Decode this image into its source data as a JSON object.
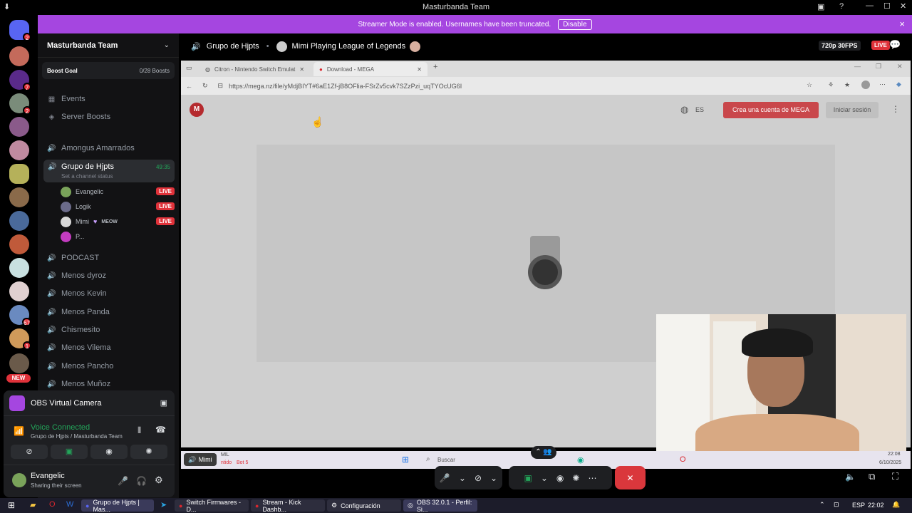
{
  "window": {
    "title": "Masturbanda Team"
  },
  "banner": {
    "message": "Streamer Mode is enabled. Usernames have been truncated.",
    "disable_label": "Disable",
    "close_icon": "×"
  },
  "server": {
    "name": "Masturbanda Team",
    "boost_goal_label": "Boost Goal",
    "boost_count": "0/28 Boosts"
  },
  "sidebar": {
    "menu": [
      {
        "label": "Events",
        "icon": "calendar-icon"
      },
      {
        "label": "Server Boosts",
        "icon": "boost-icon"
      }
    ],
    "channels_before": [
      {
        "label": "Amongus Amarrados"
      }
    ],
    "active_channel": {
      "label": "Grupo de Hjpts",
      "timer": "49:35",
      "status": "Set a channel status"
    },
    "voice_users": [
      {
        "name": "Evangelic",
        "live": "LIVE",
        "color": "#7aa35a"
      },
      {
        "name": "Logik",
        "live": "LIVE",
        "color": "#6b6b8a"
      },
      {
        "name": "Mimi",
        "tag": "MEOW",
        "live": "LIVE",
        "color": "#d8d8d8"
      },
      {
        "name": "P...",
        "color": "#c33cc0"
      }
    ],
    "channels_after": [
      {
        "label": "PODCAST"
      },
      {
        "label": "Menos dyroz"
      },
      {
        "label": "Menos Kevin"
      },
      {
        "label": "Menos Panda"
      },
      {
        "label": "Chismesito"
      },
      {
        "label": "Menos Vilema"
      },
      {
        "label": "Menos Pancho"
      },
      {
        "label": "Menos Muñoz"
      }
    ]
  },
  "server_list": {
    "new_label": "NEW",
    "badges": [
      "2",
      "7",
      "2",
      "67",
      "1"
    ]
  },
  "obs": {
    "label": "OBS Virtual Camera"
  },
  "voice": {
    "status": "Voice Connected",
    "location": "Grupo de Hjpts / Masturbanda Team"
  },
  "user": {
    "name": "Evangelic",
    "status": "Sharing their screen"
  },
  "stream_header": {
    "channel": "Grupo de Hjpts",
    "stream_title": "Mimi Playing League of Legends",
    "quality": "720p 30FPS",
    "live": "LIVE"
  },
  "browser": {
    "tabs": [
      {
        "label": "Citron - Nintendo Switch Emulat"
      },
      {
        "label": "Download - MEGA"
      }
    ],
    "url": "https://mega.nz/file/yMdjBIYT#6aE1Zf-jB8OFlia-FSrZv5cvk7SZzPzi_uqTYOcUG6I",
    "lang": "ES",
    "create_account": "Crea una cuenta de MEGA",
    "login": "Iniciar sesión"
  },
  "stream_overlay": {
    "viewer_label": "Mimi",
    "taskbar_text1": "MIL",
    "taskbar_text2": "ntido",
    "taskbar_text3": "Bot 5",
    "search_label": "Buscar",
    "clock_time": "22:08",
    "clock_date": "6/10/2025"
  },
  "taskbar": {
    "items": [
      {
        "label": "Grupo de Hjpts | Mas..."
      },
      {
        "label": "Switch Firmwares - D..."
      },
      {
        "label": "Stream - Kick Dashb..."
      },
      {
        "label": "Configuración"
      },
      {
        "label": "OBS 32.0.1 - Perfil: Si..."
      }
    ],
    "lang": "ESP",
    "time": "22:02"
  },
  "colors": {
    "accent": "#a546e0",
    "live": "#e0323a",
    "green": "#23a55a",
    "mega_red": "#d9272e"
  }
}
